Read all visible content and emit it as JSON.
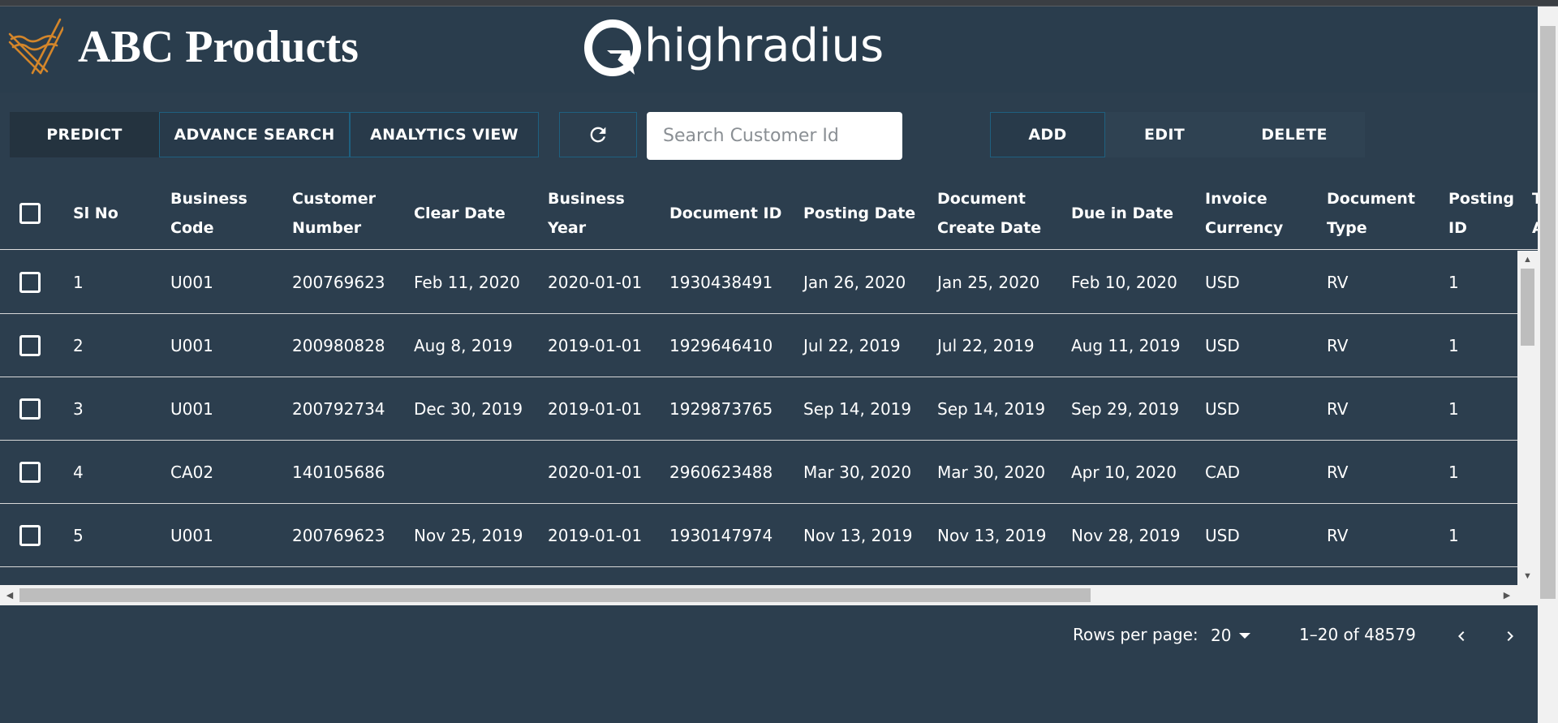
{
  "header": {
    "app_title": "ABC Products",
    "partner_logo_text": "highradius"
  },
  "toolbar": {
    "predict_label": "PREDICT",
    "advance_search_label": "ADVANCE SEARCH",
    "analytics_view_label": "ANALYTICS VIEW",
    "refresh_icon": "refresh-icon",
    "search_placeholder": "Search Customer Id",
    "add_label": "ADD",
    "edit_label": "EDIT",
    "delete_label": "DELETE"
  },
  "table": {
    "columns": [
      {
        "line1": "Sl No",
        "line2": ""
      },
      {
        "line1": "Business",
        "line2": "Code"
      },
      {
        "line1": "Customer",
        "line2": "Number"
      },
      {
        "line1": "Clear Date",
        "line2": ""
      },
      {
        "line1": "Business",
        "line2": "Year"
      },
      {
        "line1": "Document ID",
        "line2": ""
      },
      {
        "line1": "Posting Date",
        "line2": ""
      },
      {
        "line1": "Document",
        "line2": "Create Date"
      },
      {
        "line1": "Due in Date",
        "line2": ""
      },
      {
        "line1": "Invoice",
        "line2": "Currency"
      },
      {
        "line1": "Document",
        "line2": "Type"
      },
      {
        "line1": "Posting",
        "line2": "ID"
      },
      {
        "line1": "T",
        "line2": "A"
      }
    ],
    "rows": [
      [
        "1",
        "U001",
        "200769623",
        "Feb 11, 2020",
        "2020-01-01",
        "1930438491",
        "Jan 26, 2020",
        "Jan 25, 2020",
        "Feb 10, 2020",
        "USD",
        "RV",
        "1"
      ],
      [
        "2",
        "U001",
        "200980828",
        "Aug 8, 2019",
        "2019-01-01",
        "1929646410",
        "Jul 22, 2019",
        "Jul 22, 2019",
        "Aug 11, 2019",
        "USD",
        "RV",
        "1"
      ],
      [
        "3",
        "U001",
        "200792734",
        "Dec 30, 2019",
        "2019-01-01",
        "1929873765",
        "Sep 14, 2019",
        "Sep 14, 2019",
        "Sep 29, 2019",
        "USD",
        "RV",
        "1"
      ],
      [
        "4",
        "CA02",
        "140105686",
        "",
        "2020-01-01",
        "2960623488",
        "Mar 30, 2020",
        "Mar 30, 2020",
        "Apr 10, 2020",
        "CAD",
        "RV",
        "1"
      ],
      [
        "5",
        "U001",
        "200769623",
        "Nov 25, 2019",
        "2019-01-01",
        "1930147974",
        "Nov 13, 2019",
        "Nov 13, 2019",
        "Nov 28, 2019",
        "USD",
        "RV",
        "1"
      ]
    ]
  },
  "pagination": {
    "rows_per_page_label": "Rows per page:",
    "rows_per_page_value": "20",
    "range_text": "1–20 of 48579"
  },
  "colors": {
    "background": "#2c3e4e",
    "accent_border": "#1f6080",
    "logo_orange": "#d4862a"
  }
}
